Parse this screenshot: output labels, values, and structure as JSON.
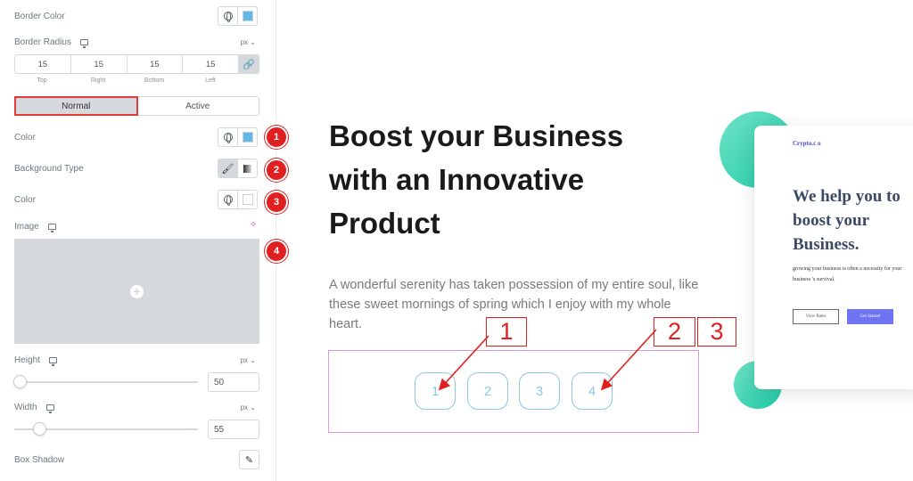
{
  "panel": {
    "border_color_label": "Border Color",
    "border_radius_label": "Border Radius",
    "border_radius_unit": "px",
    "radius_values": [
      "15",
      "15",
      "15",
      "15"
    ],
    "radius_sides": [
      "Top",
      "Right",
      "Bottom",
      "Left"
    ],
    "tabs": [
      "Normal",
      "Active"
    ],
    "color_label": "Color",
    "background_type_label": "Background Type",
    "color2_label": "Color",
    "image_label": "Image",
    "height_label": "Height",
    "height_unit": "px",
    "height_value": "50",
    "height_slider_fraction": 0,
    "width_label": "Width",
    "width_unit": "px",
    "width_value": "55",
    "width_slider_fraction": 0.1,
    "box_shadow_label": "Box Shadow",
    "swatch_color": "#61b9e6",
    "badges": [
      "1",
      "2",
      "3",
      "4"
    ]
  },
  "preview": {
    "heading": "Boost your Business with an Innovative Product",
    "paragraph": "A wonderful serenity has taken possession of my entire soul, like these sweet mornings of spring which I enjoy with my whole heart.",
    "pages": [
      "1",
      "2",
      "3",
      "4"
    ],
    "callouts": [
      "1",
      "2",
      "3"
    ],
    "card": {
      "logo": "Crypto.c o",
      "heading": "We help  you to boost  your Business.",
      "text": "growing your business is often a necessity for your business  's survival.",
      "btn1": "View Rates",
      "btn2": "Get Started"
    }
  },
  "colors": {
    "accent_red": "#e02020",
    "page_border": "#8cc9de",
    "teal": "#1fc9a5"
  }
}
